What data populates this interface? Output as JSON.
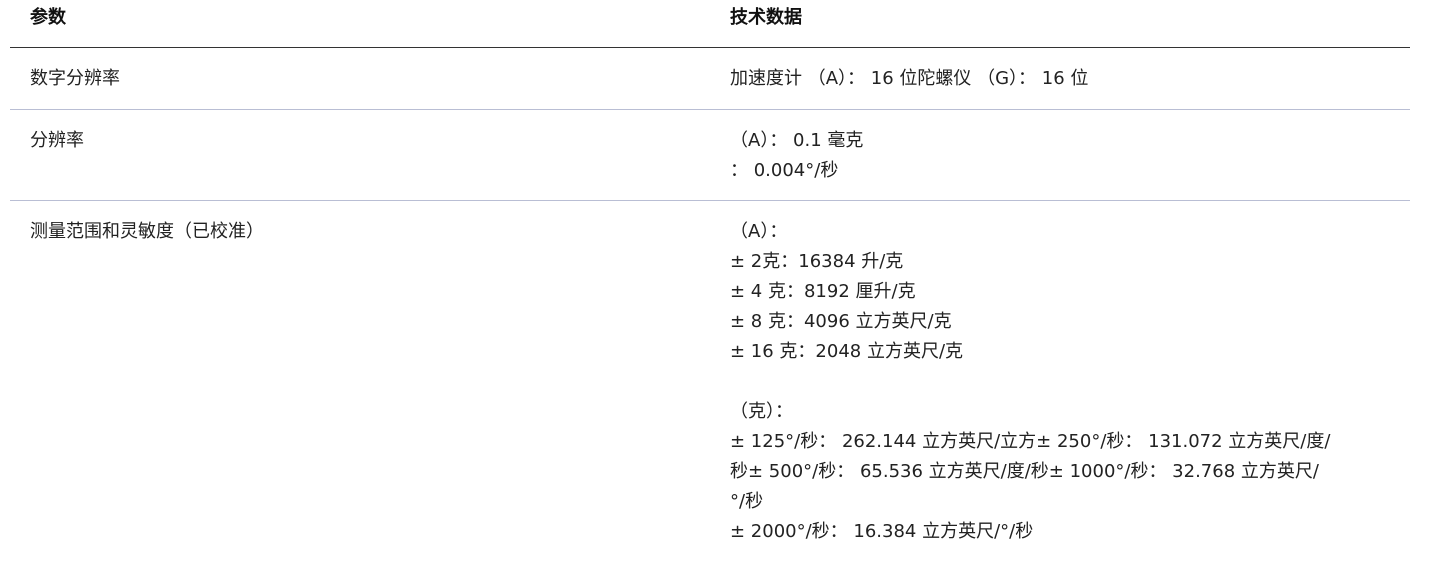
{
  "header": {
    "col1": "参数",
    "col2": "技术数据"
  },
  "rows": [
    {
      "param": "数字分辨率",
      "lines": [
        "加速度计 （A）： 16 位陀螺仪 （G）： 16 位"
      ]
    },
    {
      "param": "分辨率",
      "lines": [
        "（A）： 0.1 毫克",
        "： 0.004°/秒"
      ]
    },
    {
      "param": "测量范围和灵敏度（已校准）",
      "lines": [
        "（A）：",
        "± 2克：16384 升/克",
        "± 4 克：8192 厘升/克",
        "± 8 克：4096 立方英尺/克",
        "± 16 克：2048 立方英尺/克"
      ],
      "lines_b": [
        "（克）：",
        "± 125°/秒： 262.144 立方英尺/立方± 250°/秒： 131.072 立方英尺/度/",
        "秒± 500°/秒： 65.536 立方英尺/度/秒± 1000°/秒： 32.768 立方英尺/",
        "°/秒",
        "± 2000°/秒： 16.384 立方英尺/°/秒"
      ]
    }
  ]
}
